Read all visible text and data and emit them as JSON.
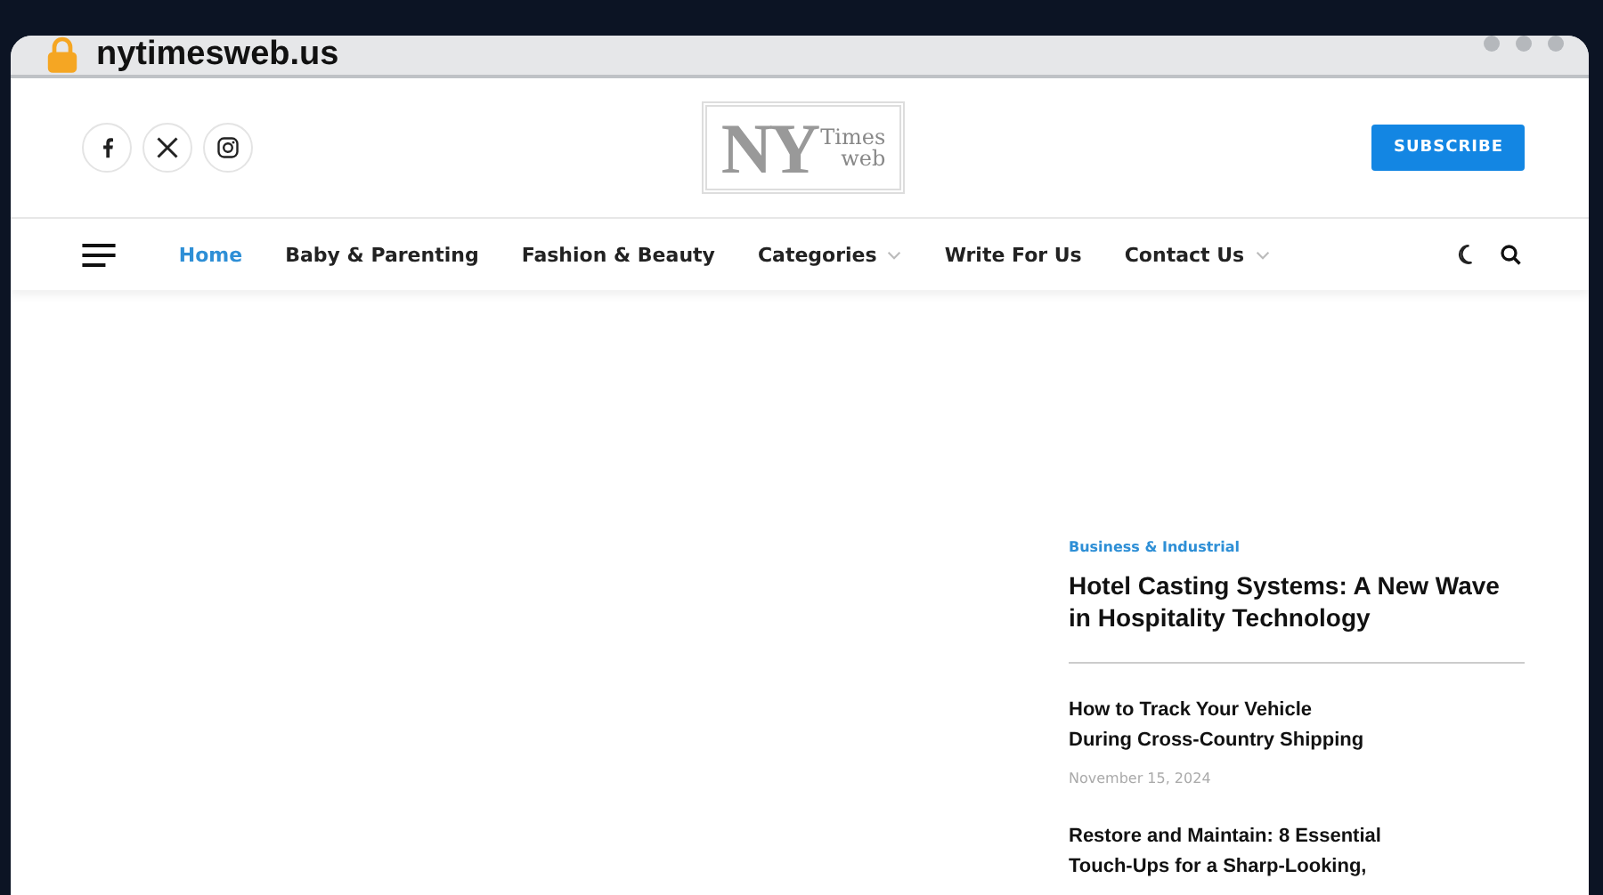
{
  "browser": {
    "address": "nytimesweb.us"
  },
  "header": {
    "social": [
      {
        "kind": "facebook"
      },
      {
        "kind": "x"
      },
      {
        "kind": "instagram"
      }
    ],
    "logo": {
      "big": "NY",
      "line_1": "Times",
      "line_2": "web"
    },
    "subscribe": "SUBSCRIBE"
  },
  "nav": {
    "items": [
      {
        "label": "Home",
        "selected": true,
        "dropdown": false
      },
      {
        "label": "Baby & Parenting",
        "selected": false,
        "dropdown": false
      },
      {
        "label": "Fashion & Beauty",
        "selected": false,
        "dropdown": false
      },
      {
        "label": "Categories",
        "selected": false,
        "dropdown": true
      },
      {
        "label": "Write For Us",
        "selected": false,
        "dropdown": false
      },
      {
        "label": "Contact Us",
        "selected": false,
        "dropdown": true
      }
    ]
  },
  "sidebar": {
    "featured": {
      "category": "Business & Industrial",
      "title": "Hotel Casting Systems: A New Wave in Hospitality Technology"
    },
    "posts": [
      {
        "title": "How to Track Your Vehicle\nDuring Cross-Country Shipping",
        "date": "November 15, 2024"
      },
      {
        "title": "Restore and Maintain: 8 Essential\nTouch-Ups for a Sharp-Looking,"
      }
    ]
  }
}
